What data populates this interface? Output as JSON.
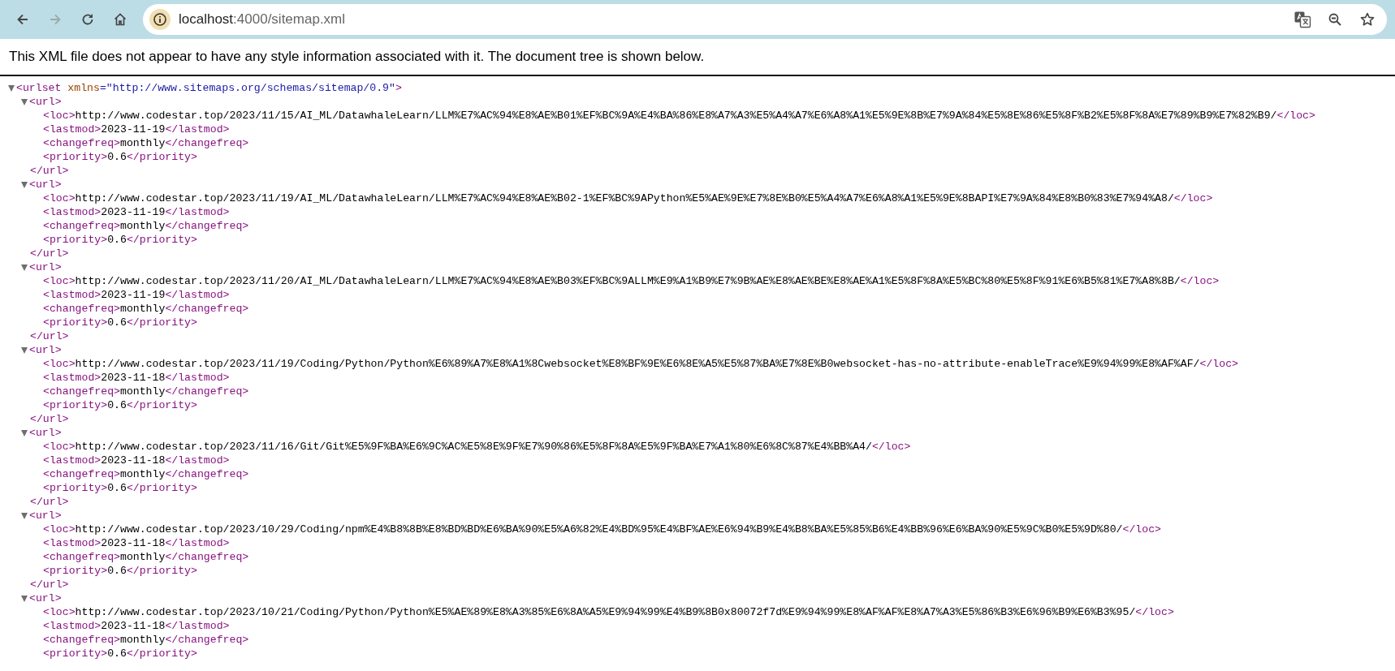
{
  "browser": {
    "back_enabled": true,
    "forward_enabled": false,
    "address": {
      "host": "localhost",
      "rest": ":4000/sitemap.xml"
    }
  },
  "notice": "This XML file does not appear to have any style information associated with it. The document tree is shown below.",
  "xml_tree": {
    "open_start": "<urlset",
    "attribute": {
      "name": "xmlns",
      "value": "=\"http://www.sitemaps.org/schemas/sitemap/0.9\""
    },
    "open_end": ">",
    "expanded": true,
    "children": [
      {
        "open": "<url>",
        "close": "</url>",
        "expanded": true,
        "children": [
          {
            "open": "<loc>",
            "text": "http://www.codestar.top/2023/11/15/AI_ML/DatawhaleLearn/LLM%E7%AC%94%E8%AE%B01%EF%BC%9A%E4%BA%86%E8%A7%A3%E5%A4%A7%E6%A8%A1%E5%9E%8B%E7%9A%84%E5%8E%86%E5%8F%B2%E5%8F%8A%E7%89%B9%E7%82%B9/",
            "close": "</loc>"
          },
          {
            "open": "<lastmod>",
            "text": "2023-11-19",
            "close": "</lastmod>"
          },
          {
            "open": "<changefreq>",
            "text": "monthly",
            "close": "</changefreq>"
          },
          {
            "open": "<priority>",
            "text": "0.6",
            "close": "</priority>"
          }
        ]
      },
      {
        "open": "<url>",
        "close": "</url>",
        "expanded": true,
        "children": [
          {
            "open": "<loc>",
            "text": "http://www.codestar.top/2023/11/19/AI_ML/DatawhaleLearn/LLM%E7%AC%94%E8%AE%B02-1%EF%BC%9APython%E5%AE%9E%E7%8E%B0%E5%A4%A7%E6%A8%A1%E5%9E%8BAPI%E7%9A%84%E8%B0%83%E7%94%A8/",
            "close": "</loc>"
          },
          {
            "open": "<lastmod>",
            "text": "2023-11-19",
            "close": "</lastmod>"
          },
          {
            "open": "<changefreq>",
            "text": "monthly",
            "close": "</changefreq>"
          },
          {
            "open": "<priority>",
            "text": "0.6",
            "close": "</priority>"
          }
        ]
      },
      {
        "open": "<url>",
        "close": "</url>",
        "expanded": true,
        "children": [
          {
            "open": "<loc>",
            "text": "http://www.codestar.top/2023/11/20/AI_ML/DatawhaleLearn/LLM%E7%AC%94%E8%AE%B03%EF%BC%9ALLM%E9%A1%B9%E7%9B%AE%E8%AE%BE%E8%AE%A1%E5%8F%8A%E5%BC%80%E5%8F%91%E6%B5%81%E7%A8%8B/",
            "close": "</loc>"
          },
          {
            "open": "<lastmod>",
            "text": "2023-11-19",
            "close": "</lastmod>"
          },
          {
            "open": "<changefreq>",
            "text": "monthly",
            "close": "</changefreq>"
          },
          {
            "open": "<priority>",
            "text": "0.6",
            "close": "</priority>"
          }
        ]
      },
      {
        "open": "<url>",
        "close": "</url>",
        "expanded": true,
        "children": [
          {
            "open": "<loc>",
            "text": "http://www.codestar.top/2023/11/19/Coding/Python/Python%E6%89%A7%E8%A1%8Cwebsocket%E8%BF%9E%E6%8E%A5%E5%87%BA%E7%8E%B0websocket-has-no-attribute-enableTrace%E9%94%99%E8%AF%AF/",
            "close": "</loc>"
          },
          {
            "open": "<lastmod>",
            "text": "2023-11-18",
            "close": "</lastmod>"
          },
          {
            "open": "<changefreq>",
            "text": "monthly",
            "close": "</changefreq>"
          },
          {
            "open": "<priority>",
            "text": "0.6",
            "close": "</priority>"
          }
        ]
      },
      {
        "open": "<url>",
        "close": "</url>",
        "expanded": true,
        "children": [
          {
            "open": "<loc>",
            "text": "http://www.codestar.top/2023/11/16/Git/Git%E5%9F%BA%E6%9C%AC%E5%8E%9F%E7%90%86%E5%8F%8A%E5%9F%BA%E7%A1%80%E6%8C%87%E4%BB%A4/",
            "close": "</loc>"
          },
          {
            "open": "<lastmod>",
            "text": "2023-11-18",
            "close": "</lastmod>"
          },
          {
            "open": "<changefreq>",
            "text": "monthly",
            "close": "</changefreq>"
          },
          {
            "open": "<priority>",
            "text": "0.6",
            "close": "</priority>"
          }
        ]
      },
      {
        "open": "<url>",
        "close": "</url>",
        "expanded": true,
        "children": [
          {
            "open": "<loc>",
            "text": "http://www.codestar.top/2023/10/29/Coding/npm%E4%B8%8B%E8%BD%BD%E6%BA%90%E5%A6%82%E4%BD%95%E4%BF%AE%E6%94%B9%E4%B8%BA%E5%85%B6%E4%BB%96%E6%BA%90%E5%9C%B0%E5%9D%80/",
            "close": "</loc>"
          },
          {
            "open": "<lastmod>",
            "text": "2023-11-18",
            "close": "</lastmod>"
          },
          {
            "open": "<changefreq>",
            "text": "monthly",
            "close": "</changefreq>"
          },
          {
            "open": "<priority>",
            "text": "0.6",
            "close": "</priority>"
          }
        ]
      },
      {
        "open": "<url>",
        "expanded": true,
        "children": [
          {
            "open": "<loc>",
            "text": "http://www.codestar.top/2023/10/21/Coding/Python/Python%E5%AE%89%E8%A3%85%E6%8A%A5%E9%94%99%E4%B9%8B0x80072f7d%E9%94%99%E8%AF%AF%E8%A7%A3%E5%86%B3%E6%96%B9%E6%B3%95/",
            "close": "</loc>"
          },
          {
            "open": "<lastmod>",
            "text": "2023-11-18",
            "close": "</lastmod>"
          },
          {
            "open": "<changefreq>",
            "text": "monthly",
            "close": "</changefreq>"
          },
          {
            "open": "<priority>",
            "text": "0.6",
            "close": "</priority>"
          }
        ]
      }
    ]
  }
}
